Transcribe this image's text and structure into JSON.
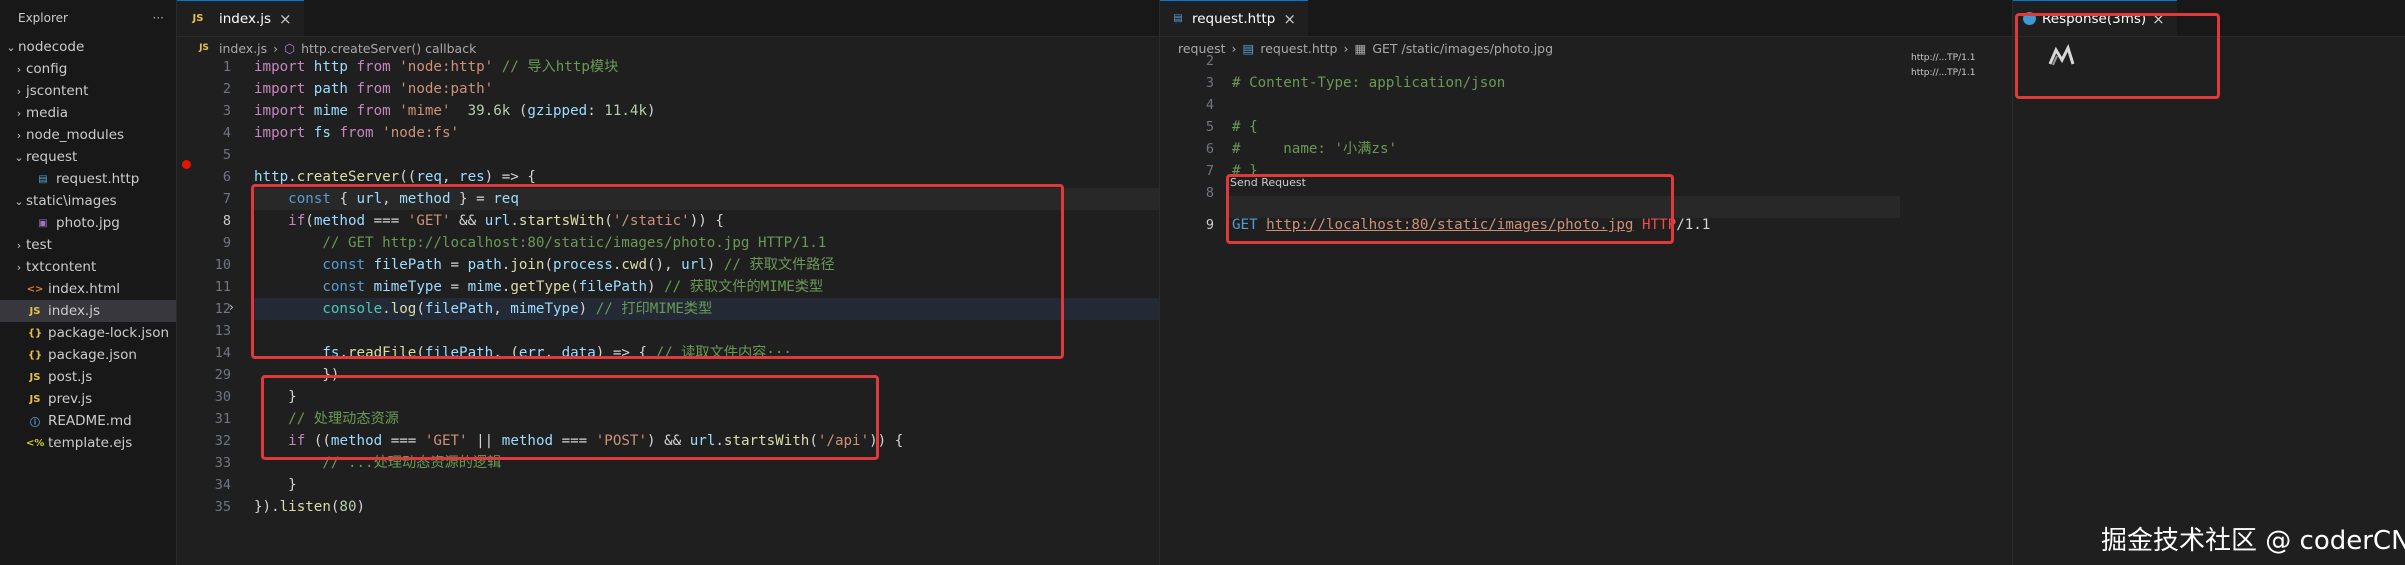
{
  "explorer": {
    "title": "Explorer",
    "more": "···",
    "root": "nodecode",
    "items": [
      {
        "label": "config",
        "chev": "›",
        "icon": "",
        "depth": 1
      },
      {
        "label": "jscontent",
        "chev": "›",
        "icon": "",
        "depth": 1
      },
      {
        "label": "media",
        "chev": "›",
        "icon": "",
        "depth": 1
      },
      {
        "label": "node_modules",
        "chev": "›",
        "icon": "",
        "depth": 1
      },
      {
        "label": "request",
        "chev": "⌄",
        "icon": "",
        "depth": 1
      },
      {
        "label": "request.http",
        "chev": "",
        "icon": "",
        "depth": 2
      },
      {
        "label": "static\\images",
        "chev": "⌄",
        "icon": "",
        "depth": 1
      },
      {
        "label": "photo.jpg",
        "chev": "",
        "icon": "▣",
        "depth": 2
      },
      {
        "label": "test",
        "chev": "›",
        "icon": "",
        "depth": 1
      },
      {
        "label": "txtcontent",
        "chev": "›",
        "icon": "",
        "depth": 1
      },
      {
        "label": "index.html",
        "chev": "",
        "icon": "<>",
        "depth": 1
      },
      {
        "label": "index.js",
        "chev": "",
        "icon": "JS",
        "depth": 1
      },
      {
        "label": "package-lock.json",
        "chev": "",
        "icon": "{}",
        "depth": 1
      },
      {
        "label": "package.json",
        "chev": "",
        "icon": "{}",
        "depth": 1
      },
      {
        "label": "post.js",
        "chev": "",
        "icon": "JS",
        "depth": 1
      },
      {
        "label": "prev.js",
        "chev": "",
        "icon": "JS",
        "depth": 1
      },
      {
        "label": "README.md",
        "chev": "",
        "icon": "ⓘ",
        "depth": 1
      },
      {
        "label": "template.ejs",
        "chev": "",
        "icon": "<%",
        "depth": 1
      }
    ]
  },
  "editor1": {
    "tab": {
      "icon": "JS",
      "label": "index.js",
      "close": "×"
    },
    "crumbs": {
      "icon": "JS",
      "file": "index.js",
      "sep": "›",
      "sym": "http.createServer() callback"
    },
    "actions": {
      "run": "▷",
      "more": "···"
    },
    "lines": [
      {
        "n": "1",
        "t": "import http from 'node:http' // 导入http模块"
      },
      {
        "n": "2",
        "t": "import path from 'node:path'"
      },
      {
        "n": "3",
        "t": "import mime from 'mime'  39.6k (gzipped: 11.4k)"
      },
      {
        "n": "4",
        "t": "import fs from 'node:fs'"
      },
      {
        "n": "5",
        "t": ""
      },
      {
        "n": "6",
        "t": "http.createServer((req, res) => {"
      },
      {
        "n": "7",
        "t": "    const { url, method } = req"
      },
      {
        "n": "8",
        "t": "    if(method === 'GET' && url.startsWith('/static')) {"
      },
      {
        "n": "9",
        "t": "        // GET http://localhost:80/static/images/photo.jpg HTTP/1.1"
      },
      {
        "n": "10",
        "t": "        const filePath = path.join(process.cwd(), url) // 获取文件路径"
      },
      {
        "n": "11",
        "t": "        const mimeType = mime.getType(filePath) // 获取文件的MIME类型"
      },
      {
        "n": "12",
        "t": "        console.log(filePath, mimeType) // 打印MIME类型"
      },
      {
        "n": "13",
        "t": ""
      },
      {
        "n": "14",
        "t": "        fs.readFile(filePath, (err, data) => { // 读取文件内容···"
      },
      {
        "n": "29",
        "t": "        })"
      },
      {
        "n": "30",
        "t": "    }"
      },
      {
        "n": "31",
        "t": "    // 处理动态资源"
      },
      {
        "n": "32",
        "t": "    if ((method === 'GET' || method === 'POST') && url.startsWith('/api')) {"
      },
      {
        "n": "33",
        "t": "        // ...处理动态资源的逻辑"
      },
      {
        "n": "34",
        "t": "    }"
      },
      {
        "n": "35",
        "t": "}).listen(80)"
      }
    ]
  },
  "editor2": {
    "tab": {
      "label": "request.http",
      "close": "×"
    },
    "crumbs": {
      "a": "request",
      "sep": "›",
      "b": "request.http",
      "c": "GET /static/images/photo.jpg"
    },
    "lines": [
      {
        "n": "2",
        "t": ""
      },
      {
        "n": "3",
        "t": "# Content-Type: application/json"
      },
      {
        "n": "4",
        "t": ""
      },
      {
        "n": "5",
        "t": "# {"
      },
      {
        "n": "6",
        "t": "#     name: '小满zs'"
      },
      {
        "n": "7",
        "t": "# }"
      },
      {
        "n": "8",
        "t": ""
      },
      {
        "n": "9",
        "t": "GET http://localhost:80/static/images/photo.jpg HTTP/1.1"
      }
    ],
    "codelens": "Send Request",
    "minimap_1": "http://...TP/1.1",
    "minimap_2": "http://...TP/1.1"
  },
  "response": {
    "tab": "Response(3ms)",
    "close": "×",
    "more": "···"
  },
  "watermark": "掘金技术社区 @ coderCN"
}
